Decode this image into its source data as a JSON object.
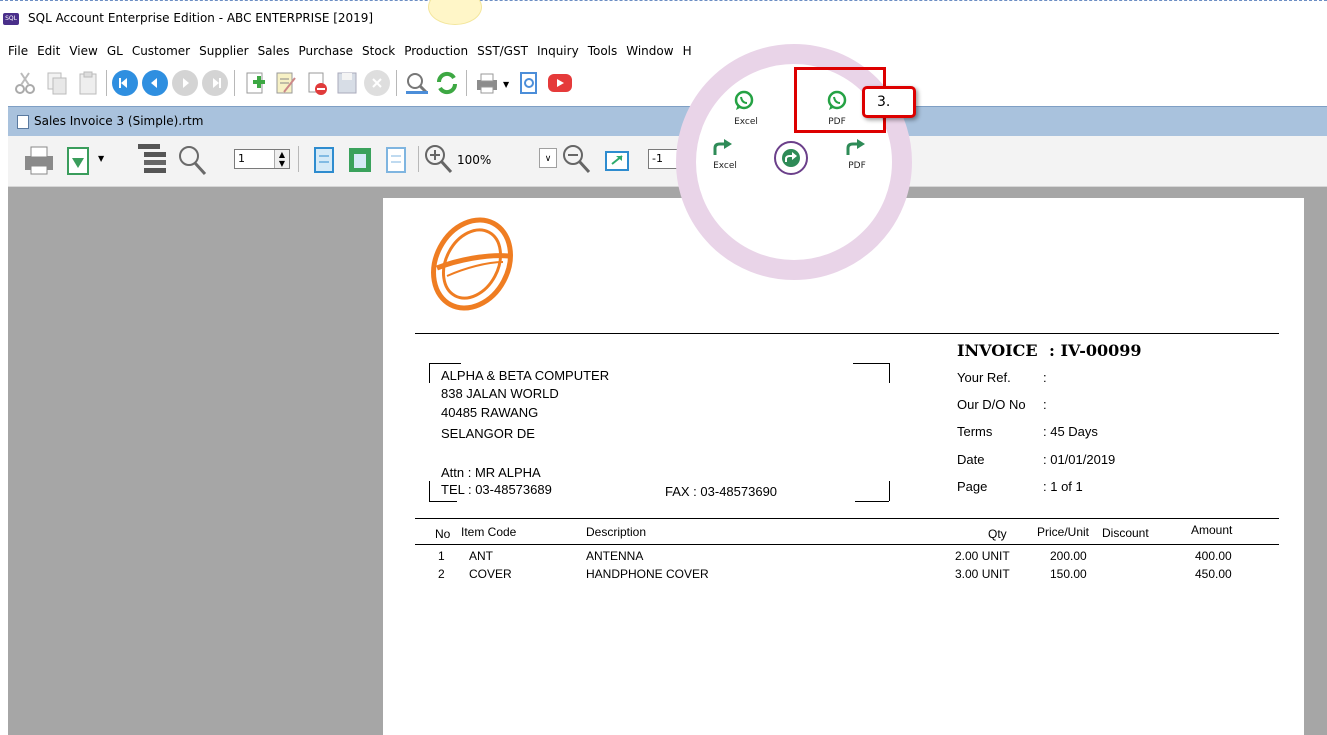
{
  "window": {
    "title": "SQL Account Enterprise Edition - ABC ENTERPRISE [2019]",
    "app_icon_text": "SQL"
  },
  "menu": [
    "File",
    "Edit",
    "View",
    "GL",
    "Customer",
    "Supplier",
    "Sales",
    "Purchase",
    "Stock",
    "Production",
    "SST/GST",
    "Inquiry",
    "Tools",
    "Window",
    "H"
  ],
  "mdi": {
    "title": "Sales Invoice 3 (Simple).rtm"
  },
  "preview_toolbar": {
    "page_number": "1",
    "zoom": "100%",
    "second_field": "-1"
  },
  "overlay": {
    "whatsapp_excel_label": "Excel",
    "whatsapp_pdf_label": "PDF",
    "share_excel_label": "Excel",
    "share_pdf_label": "PDF",
    "step_label": "3."
  },
  "invoice": {
    "heading": "INVOICE",
    "number": ": IV-00099",
    "customer": {
      "name": "ALPHA & BETA COMPUTER",
      "address1": "838 JALAN WORLD",
      "address2": "40485 RAWANG",
      "address3": "SELANGOR DE",
      "attn": "Attn : MR ALPHA",
      "tel": "TEL : 03-48573689",
      "fax": "FAX : 03-48573690"
    },
    "fields": [
      {
        "label": "Your Ref.",
        "value": ":"
      },
      {
        "label": "Our D/O No",
        "value": ":"
      },
      {
        "label": "Terms",
        "value": ": 45 Days"
      },
      {
        "label": "Date",
        "value": ": 01/01/2019"
      },
      {
        "label": "Page",
        "value": ": 1 of 1"
      }
    ],
    "columns": [
      "No",
      "Item Code",
      "Description",
      "Qty",
      "Price/Unit",
      "Discount",
      "Amount"
    ],
    "rows": [
      {
        "no": "1",
        "code": "ANT",
        "desc": "ANTENNA",
        "qty": "2.00 UNIT",
        "price": "200.00",
        "discount": "",
        "amount": "400.00"
      },
      {
        "no": "2",
        "code": "COVER",
        "desc": "HANDPHONE COVER",
        "qty": "3.00 UNIT",
        "price": "150.00",
        "discount": "",
        "amount": "450.00"
      }
    ]
  },
  "colors": {
    "logo_orange": "#ef7d22",
    "whatsapp_green": "#25a244",
    "highlight_red": "#dd0000",
    "mdi_caption": "#a9c2dd",
    "workspace_gray": "#a6a6a6"
  }
}
